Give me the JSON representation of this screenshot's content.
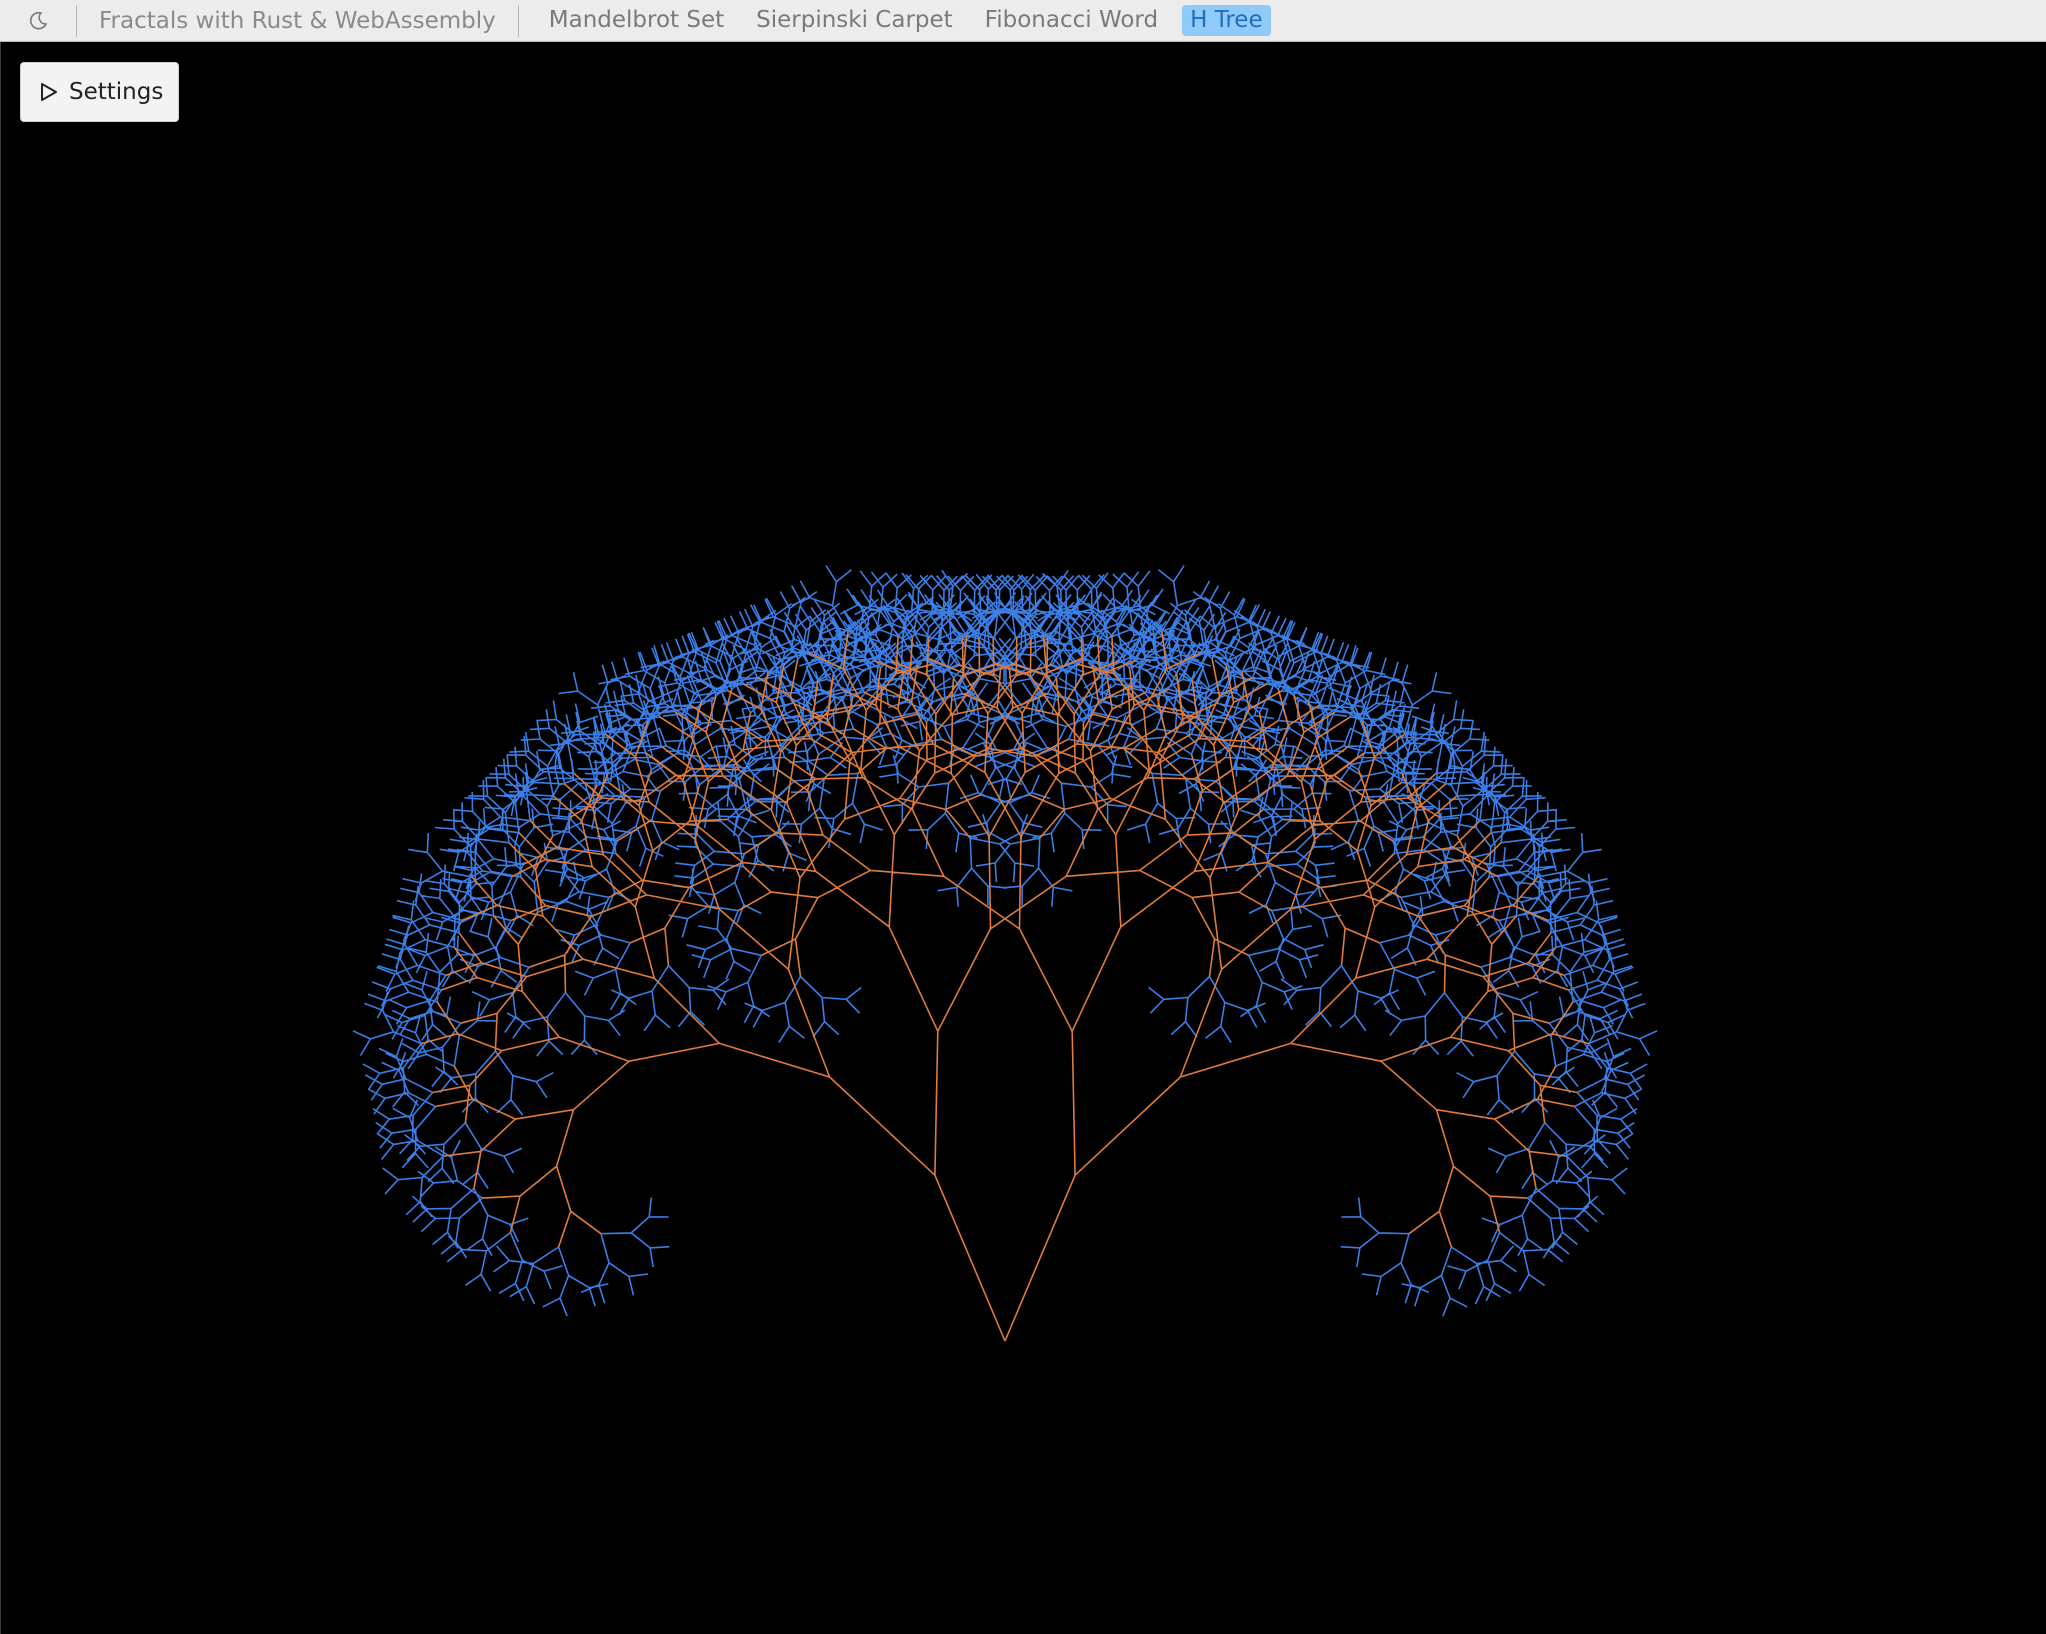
{
  "header": {
    "theme_icon": "moon-icon",
    "app_title": "Fractals with Rust & WebAssembly",
    "tabs": [
      {
        "label": "Mandelbrot Set",
        "active": false
      },
      {
        "label": "Sierpinski Carpet",
        "active": false
      },
      {
        "label": "Fibonacci Word",
        "active": false
      },
      {
        "label": "H Tree",
        "active": true
      }
    ]
  },
  "settings": {
    "label": "Settings",
    "icon": "play-triangle-icon"
  },
  "fractal": {
    "type": "branching tree",
    "trunk_color": "#e07b39",
    "leaf_color": "#3a7ee6",
    "background": "#000000"
  }
}
